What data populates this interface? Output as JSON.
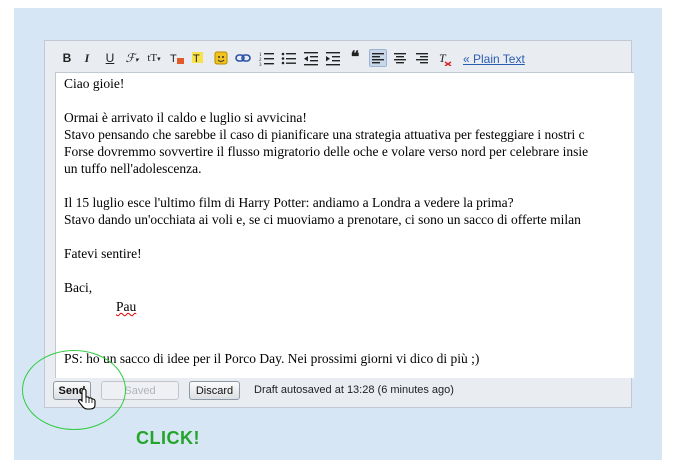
{
  "toolbar": {
    "bold": "B",
    "italic": "I",
    "underline": "U",
    "font": "𝓕",
    "size": "tT",
    "plain_text_link": "« Plain Text"
  },
  "message": {
    "lines": [
      "Ciao gioie!",
      "",
      "Ormai è arrivato il caldo e luglio si avvicina!",
      "Stavo pensando che sarebbe il caso di pianificare una strategia attuativa per festeggiare i nostri c",
      "Forse dovremmo sovvertire il flusso migratorio delle oche e volare verso nord per celebrare insie",
      "un tuffo nell'adolescenza.",
      "",
      "Il 15 luglio esce l'ultimo film di Harry Potter: andiamo a Londra a vedere la prima?",
      "Stavo dando un'occhiata ai voli e, se ci muoviamo a prenotare, ci sono un sacco di offerte milan",
      "",
      "Fatevi sentire!",
      "",
      "Baci,",
      "Pau",
      "",
      "",
      "PS: ho un sacco di idee per il Porco Day. Nei prossimi giorni vi dico di più ;)"
    ]
  },
  "actions": {
    "send_label": "Send",
    "saved_label": "Saved",
    "discard_label": "Discard",
    "draft_status": "Draft autosaved at 13:28 (6 minutes ago)"
  },
  "annotation": {
    "click_label": "CLICK!",
    "color": "#24a52a"
  },
  "colors": {
    "link": "#2a5db0",
    "backdrop": "#d6e6f4"
  }
}
